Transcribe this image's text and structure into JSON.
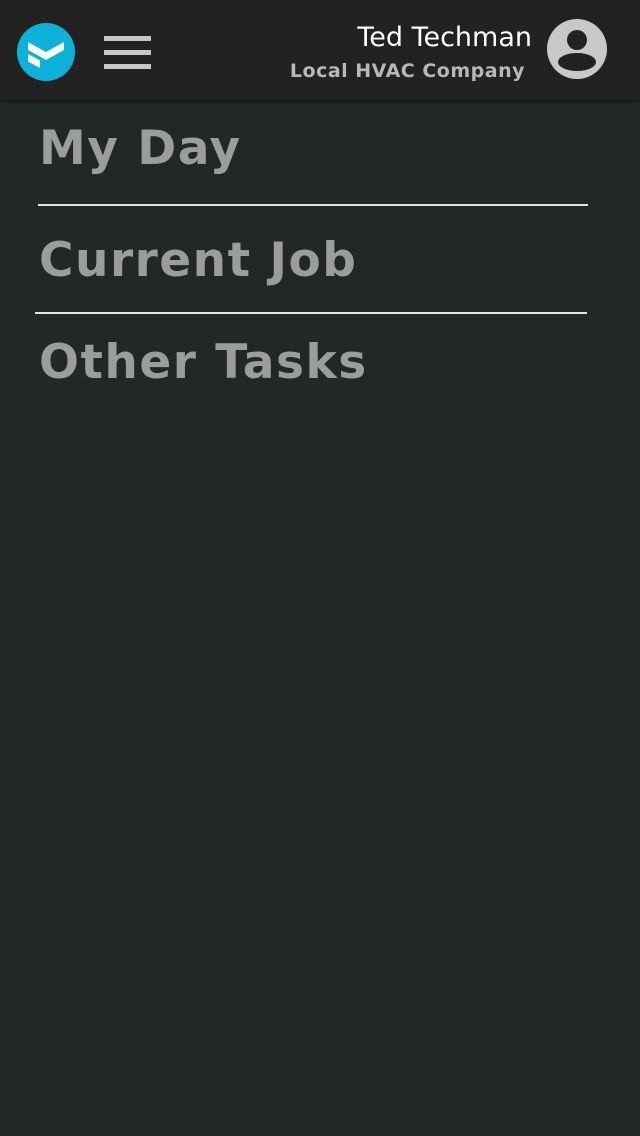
{
  "header": {
    "logo_icon": "brand-chevron-logo-icon",
    "menu_icon": "hamburger-menu-icon",
    "user_name": "Ted Techman",
    "company_name": "Local HVAC Company",
    "avatar_icon": "user-account-circle-icon",
    "brand_color": "#0db2d8"
  },
  "nav": {
    "items": [
      {
        "label": "My Day"
      },
      {
        "label": "Current Job"
      },
      {
        "label": "Other Tasks"
      }
    ]
  },
  "colors": {
    "background": "#222728",
    "header_background": "#222222",
    "nav_text": "#9a9c9d",
    "divider": "#e4e4e4"
  }
}
